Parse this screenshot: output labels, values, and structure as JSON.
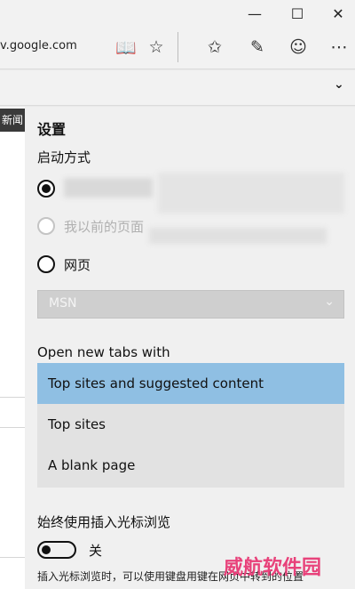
{
  "window": {
    "minimize": "—",
    "maximize": "☐",
    "close": "✕"
  },
  "addressbar": {
    "url": "v.google.com"
  },
  "toolbar": {
    "reading_view_icon": "📖",
    "favorite_icon": "☆",
    "favorites_hub_icon": "✩",
    "web_note_icon": "✎",
    "feedback_icon": "☺",
    "more_icon": "⋯"
  },
  "favbar": {
    "chevron": "⌄"
  },
  "page": {
    "news_tab": "新闻"
  },
  "settings": {
    "title": "设置",
    "startup_heading": "启动方式",
    "startup_option_2": "我以前的页面",
    "startup_option_3": "网页",
    "startup_select_value": "MSN",
    "select_chevron": "⌄",
    "newtabs_heading": "Open new tabs with",
    "newtabs_options": [
      "Top sites and suggested content",
      "Top sites",
      "A blank page"
    ],
    "caret_heading": "始终使用插入光标浏览",
    "caret_toggle_state": "关",
    "caret_help": "插入光标浏览时，可以使用键盘用键在网页中转到的位置"
  },
  "watermark": "威航软件园"
}
